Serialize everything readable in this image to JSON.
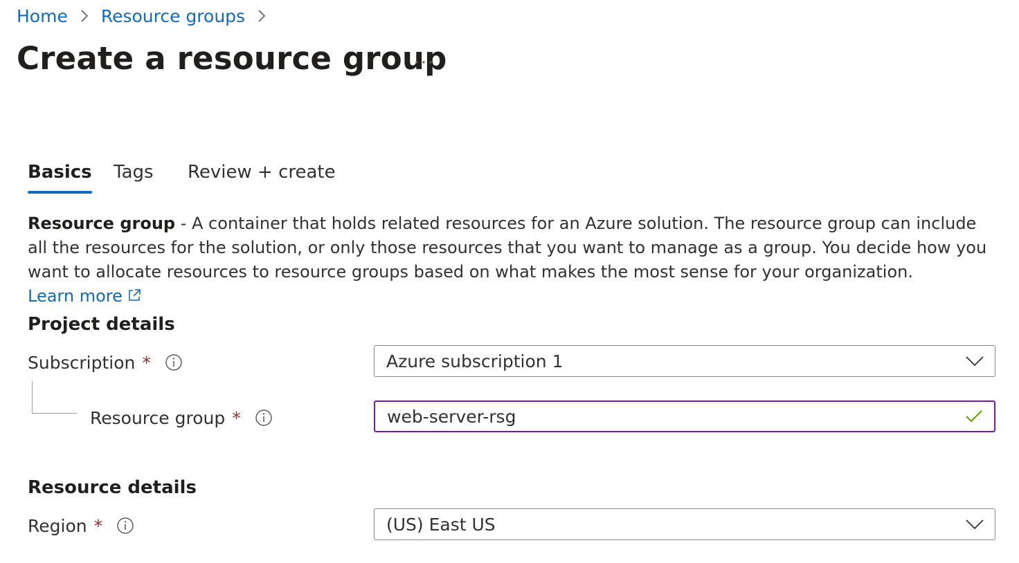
{
  "breadcrumb": {
    "items": [
      {
        "label": "Home"
      },
      {
        "label": "Resource groups"
      }
    ]
  },
  "header": {
    "title": "Create a resource group",
    "more_label": "..."
  },
  "tabs": [
    {
      "label": "Basics",
      "active": true
    },
    {
      "label": "Tags",
      "active": false
    },
    {
      "label": "Review + create",
      "active": false
    }
  ],
  "description": {
    "lead": "Resource group",
    "body": " - A container that holds related resources for an Azure solution. The resource group can include all the resources for the solution, or only those resources that you want to manage as a group. You decide how you want to allocate resources to resource groups based on what makes the most sense for your organization. ",
    "link_label": "Learn more"
  },
  "project_details": {
    "title": "Project details",
    "subscription": {
      "label": "Subscription",
      "required_mark": "*",
      "value": "Azure subscription 1"
    },
    "resource_group": {
      "label": "Resource group",
      "required_mark": "*",
      "value": "web-server-rsg",
      "valid": true
    }
  },
  "resource_details": {
    "title": "Resource details",
    "region": {
      "label": "Region",
      "required_mark": "*",
      "value": "(US) East US"
    }
  },
  "colors": {
    "link": "#0f6cbd",
    "required": "#a4262c",
    "focus_border": "#7719aa",
    "valid_check": "#57a300",
    "tab_underline": "#0f6cbd"
  },
  "icons": {
    "breadcrumb_separator": "chevron-right-icon",
    "more": "ellipsis-icon",
    "info": "info-icon",
    "dropdown": "chevron-down-icon",
    "valid": "checkmark-icon",
    "external_link": "external-link-icon"
  }
}
